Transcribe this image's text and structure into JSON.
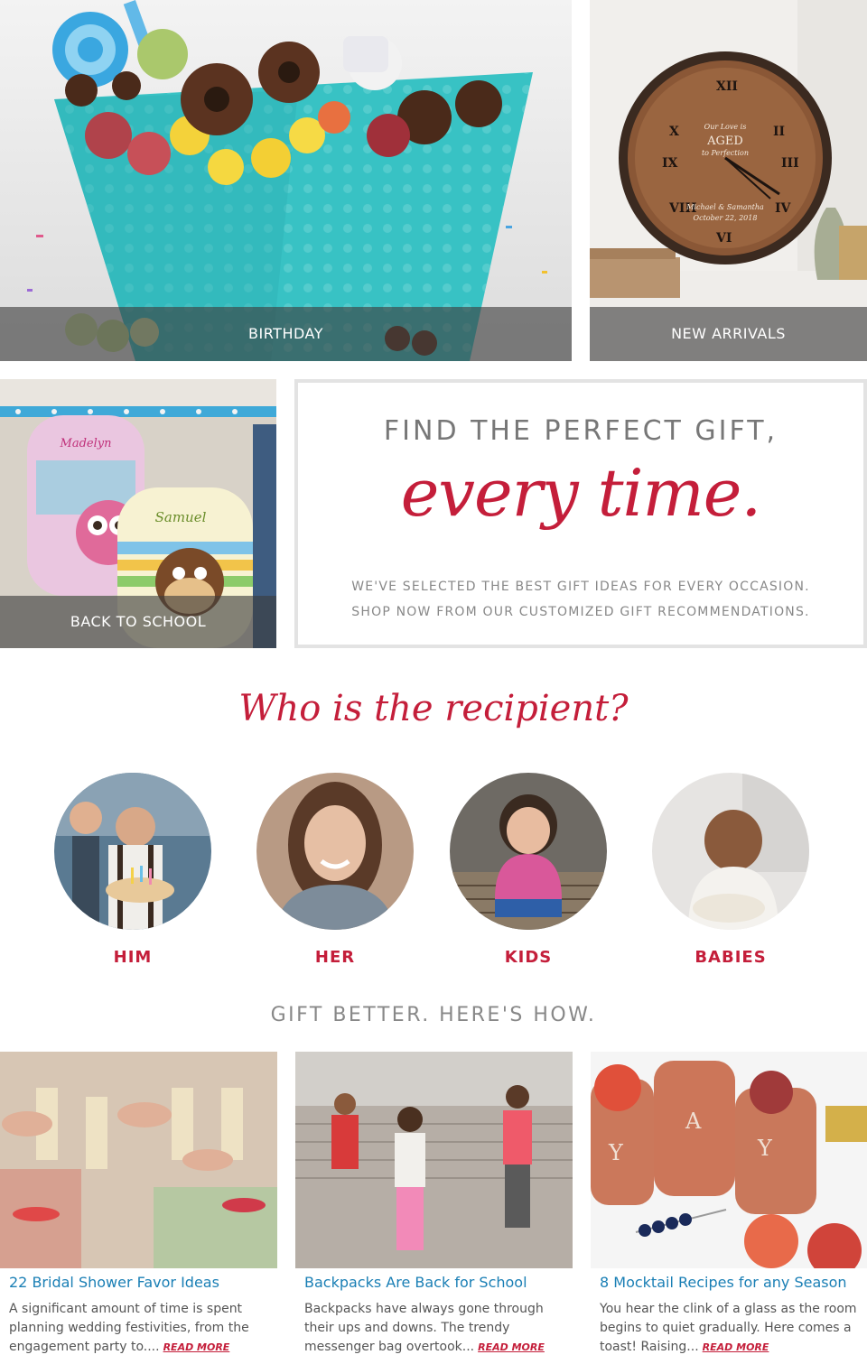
{
  "tiles": {
    "birthday": "BIRTHDAY",
    "new_arrivals": "NEW ARRIVALS",
    "back_to_school": "BACK TO SCHOOL"
  },
  "promo": {
    "headline": "FIND THE PERFECT GIFT,",
    "script": "every time.",
    "sub1": "WE'VE SELECTED THE BEST GIFT IDEAS FOR EVERY OCCASION.",
    "sub2": "SHOP NOW FROM OUR CUSTOMIZED GIFT RECOMMENDATIONS."
  },
  "recipient": {
    "title": "Who is the recipient?",
    "items": [
      {
        "label": "HIM"
      },
      {
        "label": "HER"
      },
      {
        "label": "KIDS"
      },
      {
        "label": "BABIES"
      }
    ]
  },
  "tips": {
    "title": "GIFT BETTER. HERE'S HOW.",
    "articles": [
      {
        "title": "22 Bridal Shower Favor Ideas",
        "excerpt": "A significant amount of time is spent planning wedding festivities, from the engagement party to....",
        "more": "READ MORE"
      },
      {
        "title": "Backpacks Are Back for School",
        "excerpt": "Backpacks have always gone through their ups and downs.  The trendy messenger bag overtook...",
        "more": "READ MORE"
      },
      {
        "title": "8 Mocktail Recipes for any Season",
        "excerpt": "You hear the clink of a glass as the room begins to quiet gradually. Here comes a toast! Raising...",
        "more": "READ MORE"
      }
    ]
  },
  "clock_text": {
    "line1": "Our Love is",
    "line2": "AGED",
    "line3": "to Perfection",
    "names": "Michael & Samantha",
    "date": "October 22, 2018"
  },
  "backpack_names": {
    "first": "Madelyn",
    "second": "Samuel"
  },
  "colors": {
    "accent_red": "#c41e3a",
    "link_blue": "#1a7fb5",
    "caption_bg": "#3c3c3c"
  }
}
